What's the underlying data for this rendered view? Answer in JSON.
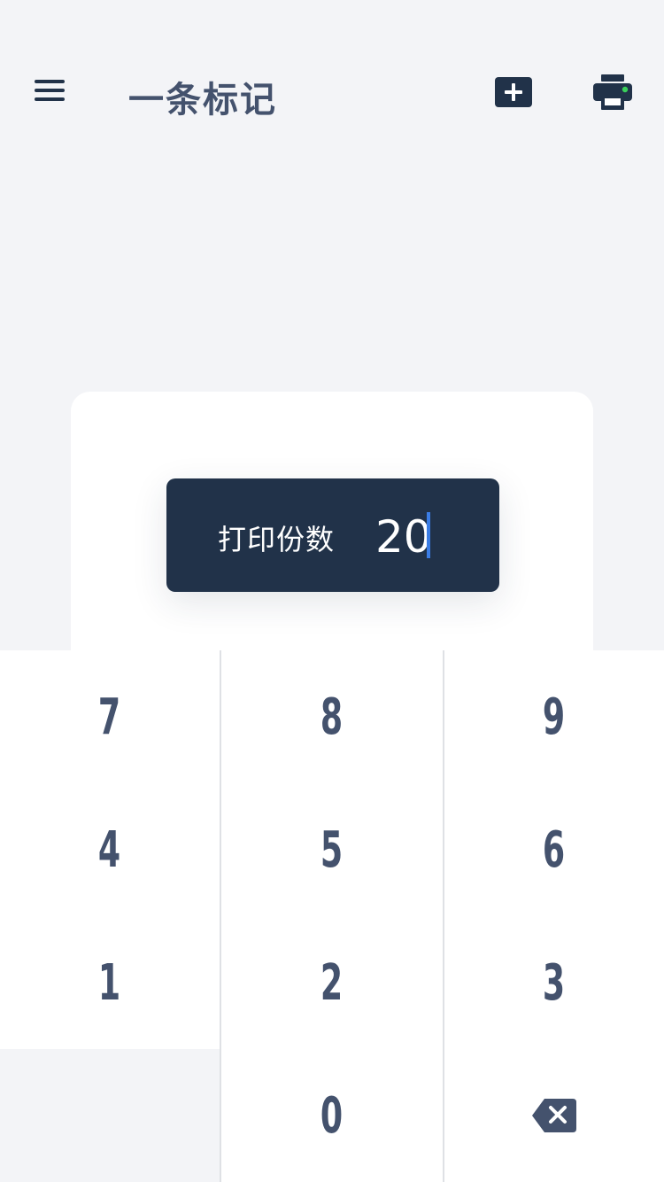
{
  "header": {
    "title": "一条标记",
    "menu_icon": "hamburger-menu-icon",
    "add_icon": "add-label-icon",
    "printer_icon": "printer-icon",
    "printer_status_color": "#3ad05a"
  },
  "copies": {
    "label": "打印份数",
    "value": "20"
  },
  "keypad": {
    "keys": [
      "7",
      "8",
      "9",
      "4",
      "5",
      "6",
      "1",
      "2",
      "3",
      "0"
    ],
    "backspace_icon": "backspace-icon"
  },
  "colors": {
    "accent_dark": "#213249",
    "text": "#44526d",
    "cursor": "#3b7de5",
    "background": "#f3f4f7"
  }
}
